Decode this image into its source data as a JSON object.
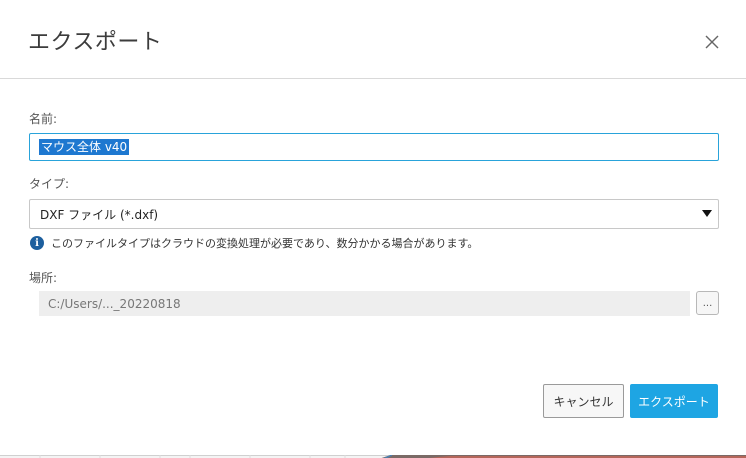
{
  "dialog": {
    "title": "エクスポート",
    "close_icon": "close-icon"
  },
  "form": {
    "name_label": "名前:",
    "name_value": "マウス全体 v40",
    "type_label": "タイプ:",
    "type_value": "DXF ファイル (*.dxf)",
    "info_icon": "info-icon",
    "info_text": "このファイルタイプはクラウドの変換処理が必要であり、数分かかる場合があります。",
    "location_label": "場所:",
    "location_value": "C:/Users/..._20220818",
    "browse_label": "..."
  },
  "buttons": {
    "cancel_label": "キャンセル",
    "export_label": "エクスポート"
  },
  "colors": {
    "accent": "#1ea5e3",
    "selection": "#1e78d0",
    "info_icon": "#1d5f9e"
  }
}
